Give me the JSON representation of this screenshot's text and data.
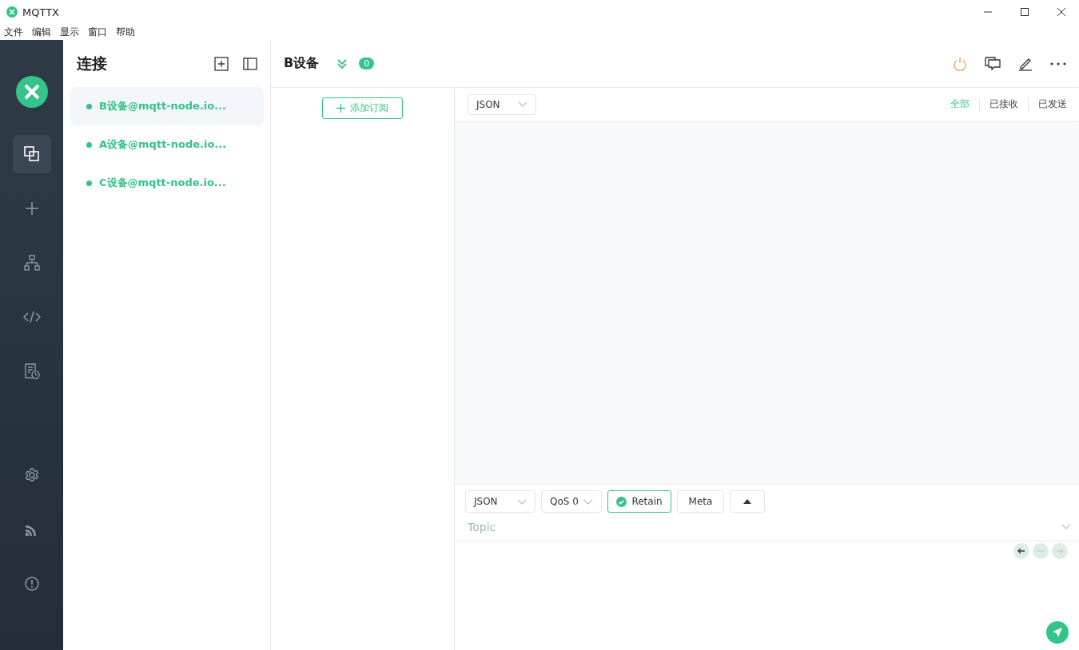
{
  "window": {
    "title": "MQTTX"
  },
  "menu": [
    "文件",
    "编辑",
    "显示",
    "窗口",
    "帮助"
  ],
  "nav": [
    {
      "selected": true
    },
    {
      "selected": false
    },
    {
      "selected": false
    },
    {
      "selected": false
    },
    {
      "selected": false
    },
    {
      "selected": false
    },
    {
      "selected": false
    },
    {
      "selected": false
    }
  ],
  "connections_panel": {
    "title": "连接",
    "items": [
      {
        "name": "B设备@mqtt-node.io...",
        "selected": true
      },
      {
        "name": "A设备@mqtt-node.io...",
        "selected": false
      },
      {
        "name": "C设备@mqtt-node.io...",
        "selected": false
      }
    ]
  },
  "header": {
    "title": "B设备",
    "badge": "0"
  },
  "subscriptions": {
    "add_button": "添加订阅"
  },
  "messages": {
    "format": "JSON",
    "filters": [
      {
        "label": "全部",
        "selected": true
      },
      {
        "label": "已接收",
        "selected": false
      },
      {
        "label": "已发送",
        "selected": false
      }
    ]
  },
  "publish": {
    "format": "JSON",
    "qos": "QoS 0",
    "retain": {
      "label": "Retain",
      "checked": true
    },
    "meta": "Meta",
    "topic_placeholder": "Topic"
  }
}
